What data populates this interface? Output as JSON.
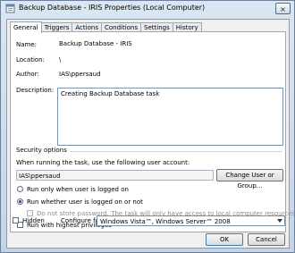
{
  "window": {
    "title": "Backup Database - IRIS Properties (Local Computer)",
    "close_label": "×"
  },
  "tabs": [
    {
      "label": "General",
      "active": true
    },
    {
      "label": "Triggers"
    },
    {
      "label": "Actions"
    },
    {
      "label": "Conditions"
    },
    {
      "label": "Settings"
    },
    {
      "label": "History"
    }
  ],
  "general": {
    "name_label": "Name:",
    "name_value": "Backup Database - IRIS",
    "location_label": "Location:",
    "location_value": "\\",
    "author_label": "Author:",
    "author_value": "IAS\\ppersaud",
    "description_label": "Description:",
    "description_value": "Creating Backup Database task"
  },
  "security": {
    "heading": "Security options",
    "account_prompt": "When running the task, use the following user account:",
    "user_account": "IAS\\ppersaud",
    "change_user_button": "Change User or Group...",
    "radio_logged_on": "Run only when user is logged on",
    "radio_whether": "Run whether user is logged on or not",
    "radio_whether_selected": true,
    "no_store_password": "Do not store password.  The task will only have access to local computer resources.",
    "highest_privileges": "Run with highest privileges"
  },
  "footer": {
    "hidden_label": "Hidden",
    "configure_label": "Configure for:",
    "configure_value": "Windows Vista™, Windows Server™ 2008",
    "ok_button": "OK",
    "cancel_button": "Cancel"
  }
}
